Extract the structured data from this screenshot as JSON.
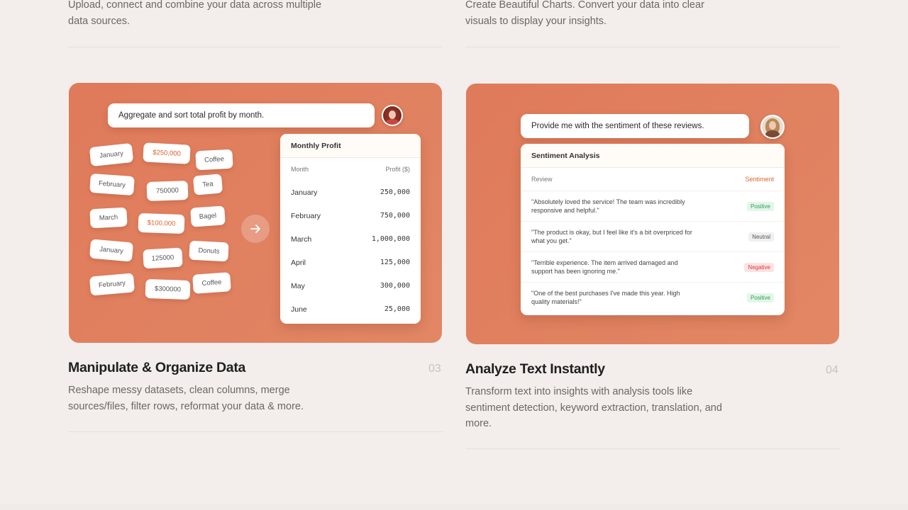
{
  "top": {
    "left_desc": "Upload, connect and combine your data across multiple data sources.",
    "right_desc": "Create Beautiful Charts. Convert your data into clear visuals to display your insights."
  },
  "left_card": {
    "prompt": "Aggregate and sort total profit by month.",
    "chips": [
      "January",
      "$250,000",
      "Coffee",
      "February",
      "750000",
      "Tea",
      "March",
      "$100,000",
      "Bagel",
      "January",
      "125000",
      "Donuts",
      "February",
      "$300000",
      "Coffee"
    ],
    "table": {
      "title": "Monthly Profit",
      "col_month": "Month",
      "col_profit": "Profit ($)",
      "rows": [
        {
          "month": "January",
          "profit": "250,000"
        },
        {
          "month": "February",
          "profit": "750,000"
        },
        {
          "month": "March",
          "profit": "1,000,000"
        },
        {
          "month": "April",
          "profit": "125,000"
        },
        {
          "month": "May",
          "profit": "300,000"
        },
        {
          "month": "June",
          "profit": "25,000"
        }
      ]
    }
  },
  "right_card": {
    "prompt": "Provide me with the sentiment of these reviews.",
    "table": {
      "title": "Sentiment Analysis",
      "col_review": "Review",
      "col_sentiment": "Sentiment",
      "rows": [
        {
          "review": "\"Absolutely loved the service! The team was incredibly responsive and helpful.\"",
          "sentiment": "Positive"
        },
        {
          "review": "\"The product is okay, but I feel like it's a bit overpriced for what you get.\"",
          "sentiment": "Neutral"
        },
        {
          "review": "\"Terrible experience. The item arrived damaged and support has been ignoring me.\"",
          "sentiment": "Negative"
        },
        {
          "review": "\"One of the best purchases I've made this year. High quality materials!\"",
          "sentiment": "Positive"
        }
      ]
    }
  },
  "features": [
    {
      "title": "Manipulate & Organize Data",
      "number": "03",
      "desc": "Reshape messy datasets, clean columns, merge sources/files, filter rows, reformat your data & more."
    },
    {
      "title": "Analyze Text Instantly",
      "number": "04",
      "desc": "Transform text into insights with analysis tools like sentiment detection, keyword extraction, translation, and more."
    }
  ],
  "colors": {
    "card_accent": "#df7a5a",
    "accent_text": "#e0642f",
    "positive": "#2f9e55",
    "negative": "#d93838"
  }
}
